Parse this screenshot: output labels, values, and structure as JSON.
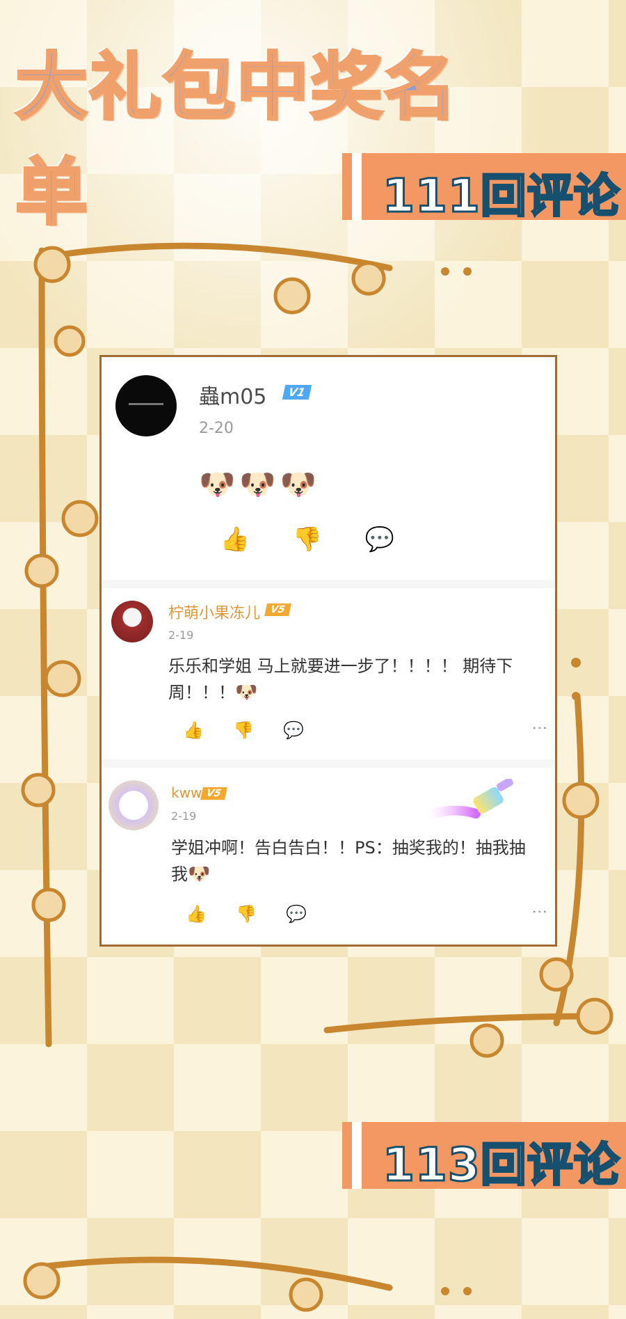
{
  "page": {
    "title": "大礼包中奖名单",
    "label_top": "111回评论",
    "label_bottom": "113回评论"
  },
  "comments": [
    {
      "username": "蟲m05",
      "badge": "V1",
      "date": "2-20",
      "text": "🐶🐶🐶",
      "actions": {
        "like": "👍",
        "dislike": "👎",
        "reply": "💬"
      }
    },
    {
      "username": "柠萌小果冻儿",
      "badge": "V5",
      "date": "2-19",
      "text": "乐乐和学姐 马上就要进一步了！！！！ 期待下周！！！",
      "emoji": "🐶",
      "actions": {
        "like": "👍",
        "dislike": "👎",
        "reply": "💬",
        "more": "⋮"
      }
    },
    {
      "username": "kww",
      "badge": "V5",
      "date": "2-19",
      "text": "学姐冲啊！告白告白！！PS：抽奖我的！抽我抽我",
      "emoji": "🐶",
      "actions": {
        "like": "👍",
        "dislike": "👎",
        "reply": "💬",
        "more": "⋮"
      }
    }
  ],
  "colors": {
    "accent_orange": "#f39862",
    "frame_gold": "#c8872f",
    "label_text_stroke": "#17506f",
    "badge_blue": "#4fa8f3",
    "badge_gold": "#f3a832"
  }
}
